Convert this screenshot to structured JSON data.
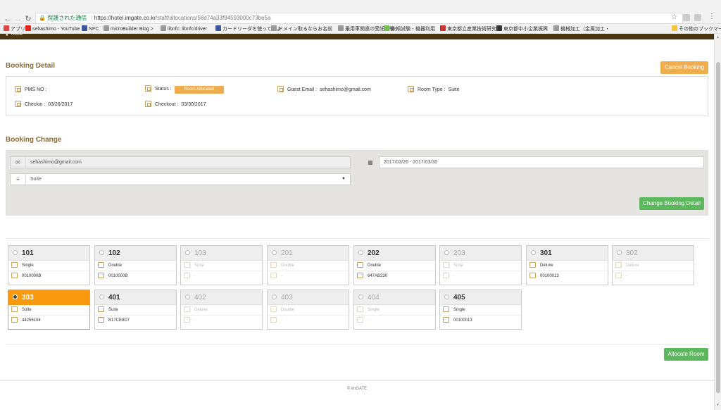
{
  "browser": {
    "secure_label": "保護された通信",
    "url_host": "https://hotel.imgate.co.kr",
    "url_path": "/staff/allocations/58d74a33f94593000c73be5a",
    "bookmarks": [
      {
        "label": "アプリ",
        "color": "#d44"
      },
      {
        "label": "sehashimo - YouTube",
        "color": "#e62117"
      },
      {
        "label": "NFC",
        "color": "#3b5998"
      },
      {
        "label": "microBuilder Blog >",
        "color": "#999"
      },
      {
        "label": "libnfc: libnfc/driver",
        "color": "#999"
      },
      {
        "label": "カードリーダを使ってみよ",
        "color": "#3b5998"
      },
      {
        "label": "ドメイン取るならお名前",
        "color": "#999"
      },
      {
        "label": "乗用車関連の受託試験",
        "color": "#999"
      },
      {
        "label": "依頼試験・機器利用",
        "color": "#7b5"
      },
      {
        "label": "東京都立産業技術研究",
        "color": "#c33"
      },
      {
        "label": "東京都中小企業振興",
        "color": "#333"
      },
      {
        "label": "機械加工（金属加工・",
        "color": "#999"
      },
      {
        "label": "その他のブックマーク",
        "color": "#f5c242"
      }
    ]
  },
  "nav": {
    "home_label": "Home"
  },
  "booking_detail": {
    "title": "Booking Detail",
    "cancel_label": "Cancel Booking",
    "pms_label": "PMS NO :",
    "pms_value": "",
    "status_label": "Status :",
    "status_value": "Room Allocated",
    "email_label": "Guest Email :",
    "email_value": "sehashimo@gmail.com",
    "roomtype_label": "Room Type :",
    "roomtype_value": "Suite",
    "checkin_label": "Checkin :",
    "checkin_value": "03/26/2017",
    "checkout_label": "Checkout :",
    "checkout_value": "03/30/2017"
  },
  "booking_change": {
    "title": "Booking Change",
    "email_value": "sehashimo@gmail.com",
    "date_range": "2017/03/26 - 2017/03/30",
    "room_type": "Suite",
    "submit_label": "Change Booking Detail"
  },
  "rooms": [
    {
      "number": "101",
      "type": "Single",
      "code": "0010000B",
      "state": "available"
    },
    {
      "number": "102",
      "type": "Double",
      "code": "0010000B",
      "state": "available"
    },
    {
      "number": "103",
      "type": "Suite",
      "code": "-",
      "state": "disabled"
    },
    {
      "number": "201",
      "type": "Double",
      "code": "-",
      "state": "disabled"
    },
    {
      "number": "202",
      "type": "Double",
      "code": "647AB230",
      "state": "available"
    },
    {
      "number": "203",
      "type": "Suite",
      "code": "-",
      "state": "disabled"
    },
    {
      "number": "301",
      "type": "Deluxe",
      "code": "00100013",
      "state": "available"
    },
    {
      "number": "302",
      "type": "Deluxe",
      "code": "-",
      "state": "disabled"
    },
    {
      "number": "303",
      "type": "Suite",
      "code": "44255104",
      "state": "selected"
    },
    {
      "number": "401",
      "type": "Suite",
      "code": "B17CE8D7",
      "state": "available"
    },
    {
      "number": "402",
      "type": "Deluxe",
      "code": "-",
      "state": "disabled"
    },
    {
      "number": "403",
      "type": "Double",
      "code": "-",
      "state": "disabled"
    },
    {
      "number": "404",
      "type": "Single",
      "code": "-",
      "state": "disabled"
    },
    {
      "number": "405",
      "type": "Single",
      "code": "00100013",
      "state": "available"
    }
  ],
  "allocate_label": "Allocate Room",
  "footer": "© imGATE"
}
